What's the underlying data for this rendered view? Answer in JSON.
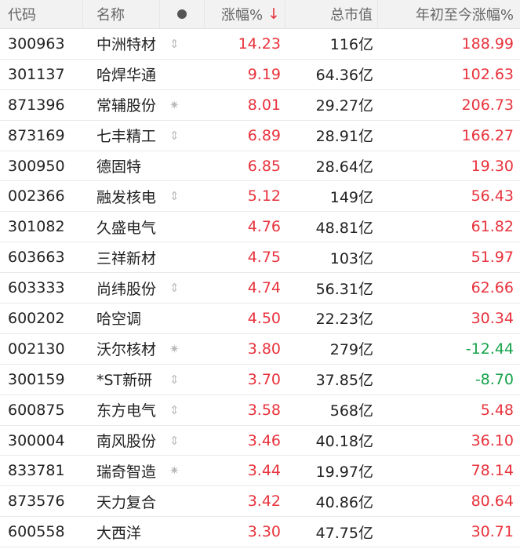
{
  "header": {
    "code": "代码",
    "name": "名称",
    "mark_icon": "dot-icon",
    "change_pct": "涨幅%",
    "sort_arrow": "↓",
    "market_cap": "总市值",
    "ytd_change": "年初至今涨幅%"
  },
  "colors": {
    "up": "#e8323c",
    "down": "#16a34a"
  },
  "rows": [
    {
      "code": "300963",
      "name": "中洲特材",
      "mark": "⇕",
      "mark_icon": "updown-arrow-icon",
      "chg": "14.23",
      "cap": "116亿",
      "ytd": "188.99",
      "ytd_dir": "up"
    },
    {
      "code": "301137",
      "name": "哈焊华通",
      "mark": "",
      "mark_icon": "",
      "chg": "9.19",
      "cap": "64.36亿",
      "ytd": "102.63",
      "ytd_dir": "up"
    },
    {
      "code": "871396",
      "name": "常辅股份",
      "mark": "✷",
      "mark_icon": "star-icon",
      "chg": "8.01",
      "cap": "29.27亿",
      "ytd": "206.73",
      "ytd_dir": "up"
    },
    {
      "code": "873169",
      "name": "七丰精工",
      "mark": "⇕",
      "mark_icon": "updown-arrow-icon",
      "chg": "6.89",
      "cap": "28.91亿",
      "ytd": "166.27",
      "ytd_dir": "up"
    },
    {
      "code": "300950",
      "name": "德固特",
      "mark": "",
      "mark_icon": "",
      "chg": "6.85",
      "cap": "28.64亿",
      "ytd": "19.30",
      "ytd_dir": "up"
    },
    {
      "code": "002366",
      "name": "融发核电",
      "mark": "⇕",
      "mark_icon": "updown-arrow-icon",
      "chg": "5.12",
      "cap": "149亿",
      "ytd": "56.43",
      "ytd_dir": "up"
    },
    {
      "code": "301082",
      "name": "久盛电气",
      "mark": "",
      "mark_icon": "",
      "chg": "4.76",
      "cap": "48.81亿",
      "ytd": "61.82",
      "ytd_dir": "up"
    },
    {
      "code": "603663",
      "name": "三祥新材",
      "mark": "",
      "mark_icon": "",
      "chg": "4.75",
      "cap": "103亿",
      "ytd": "51.97",
      "ytd_dir": "up"
    },
    {
      "code": "603333",
      "name": "尚纬股份",
      "mark": "⇕",
      "mark_icon": "updown-arrow-icon",
      "chg": "4.74",
      "cap": "56.31亿",
      "ytd": "62.66",
      "ytd_dir": "up"
    },
    {
      "code": "600202",
      "name": "哈空调",
      "mark": "",
      "mark_icon": "",
      "chg": "4.50",
      "cap": "22.23亿",
      "ytd": "30.34",
      "ytd_dir": "up"
    },
    {
      "code": "002130",
      "name": "沃尔核材",
      "mark": "✷",
      "mark_icon": "star-icon",
      "chg": "3.80",
      "cap": "279亿",
      "ytd": "-12.44",
      "ytd_dir": "down"
    },
    {
      "code": "300159",
      "name": "*ST新研",
      "mark": "⇕",
      "mark_icon": "updown-arrow-icon",
      "chg": "3.70",
      "cap": "37.85亿",
      "ytd": "-8.70",
      "ytd_dir": "down"
    },
    {
      "code": "600875",
      "name": "东方电气",
      "mark": "⇕",
      "mark_icon": "updown-arrow-icon",
      "chg": "3.58",
      "cap": "568亿",
      "ytd": "5.48",
      "ytd_dir": "up"
    },
    {
      "code": "300004",
      "name": "南风股份",
      "mark": "⇕",
      "mark_icon": "updown-arrow-icon",
      "chg": "3.46",
      "cap": "40.18亿",
      "ytd": "36.10",
      "ytd_dir": "up"
    },
    {
      "code": "833781",
      "name": "瑞奇智造",
      "mark": "✷",
      "mark_icon": "star-icon",
      "chg": "3.44",
      "cap": "19.97亿",
      "ytd": "78.14",
      "ytd_dir": "up"
    },
    {
      "code": "873576",
      "name": "天力复合",
      "mark": "",
      "mark_icon": "",
      "chg": "3.42",
      "cap": "40.86亿",
      "ytd": "80.64",
      "ytd_dir": "up"
    },
    {
      "code": "600558",
      "name": "大西洋",
      "mark": "",
      "mark_icon": "",
      "chg": "3.30",
      "cap": "47.75亿",
      "ytd": "30.71",
      "ytd_dir": "up"
    }
  ]
}
